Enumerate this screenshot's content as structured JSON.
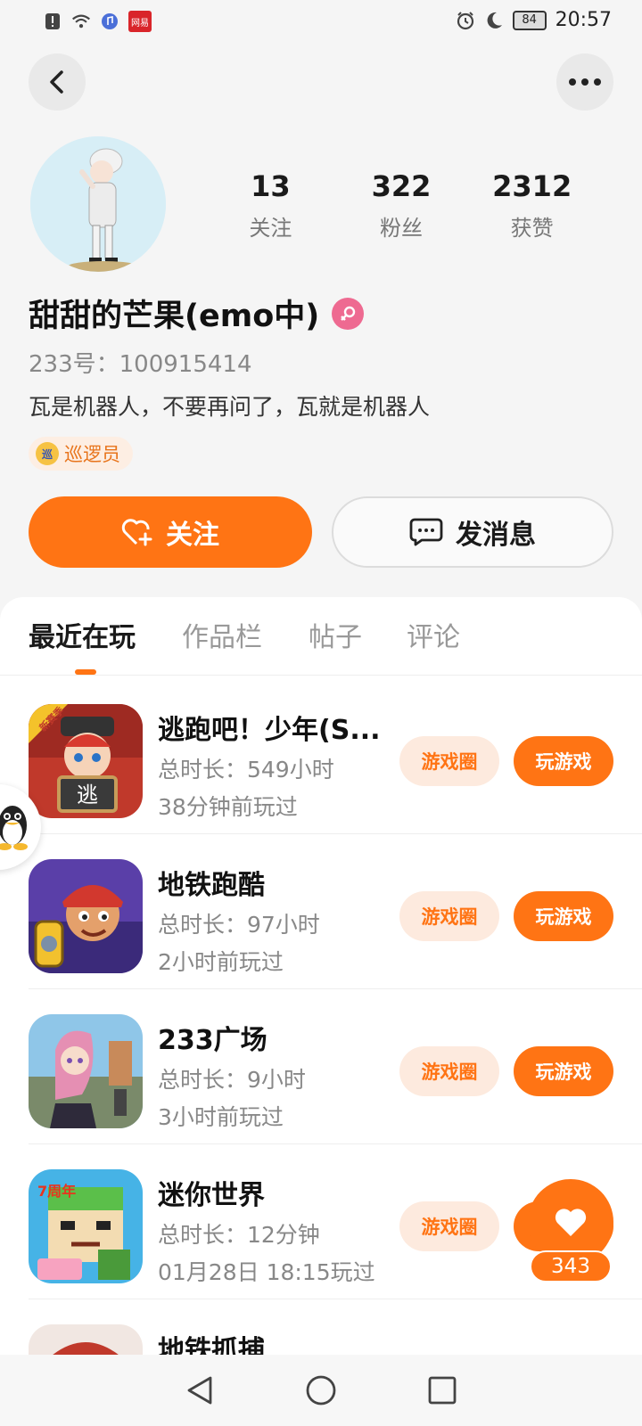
{
  "status_bar": {
    "time": "20:57",
    "battery": "84",
    "app_badge": "网易"
  },
  "profile": {
    "stats": [
      {
        "value": "13",
        "label": "关注"
      },
      {
        "value": "322",
        "label": "粉丝"
      },
      {
        "value": "2312",
        "label": "获赞"
      }
    ],
    "nickname": "甜甜的芒果(emo中)",
    "uid": "233号：100915414",
    "bio": "瓦是机器人，不要再问了，瓦就是机器人",
    "badge": "巡逻员",
    "badge_icon_char": "巡"
  },
  "actions": {
    "follow_label": "关注",
    "message_label": "发消息"
  },
  "tabs": [
    {
      "label": "最近在玩",
      "active": true
    },
    {
      "label": "作品栏",
      "active": false
    },
    {
      "label": "帖子",
      "active": false
    },
    {
      "label": "评论",
      "active": false
    }
  ],
  "games": [
    {
      "name": "逃跑吧！少年(S...",
      "total_time": "总时长：549小时",
      "last_played": "38分钟前玩过",
      "icon": "escape-game-icon",
      "icon_overlay": "逃",
      "icon_tag": "新赛季"
    },
    {
      "name": "地铁跑酷",
      "total_time": "总时长：97小时",
      "last_played": "2小时前玩过",
      "icon": "subway-surfers-icon"
    },
    {
      "name": "233广场",
      "total_time": "总时长：9小时",
      "last_played": "3小时前玩过",
      "icon": "plaza-233-icon"
    },
    {
      "name": "迷你世界",
      "total_time": "总时长：12分钟",
      "last_played": "01月28日 18:15玩过",
      "icon": "mini-world-icon",
      "icon_tag": "7周年"
    },
    {
      "name": "地铁抓捕",
      "icon": "subway-catch-icon"
    }
  ],
  "game_buttons": {
    "circle_label": "游戏圈",
    "play_label": "玩游戏"
  },
  "like_float": {
    "count": "343"
  },
  "colors": {
    "accent": "#ff7414",
    "accent_soft": "#fdeade",
    "female": "#ee6a91"
  }
}
